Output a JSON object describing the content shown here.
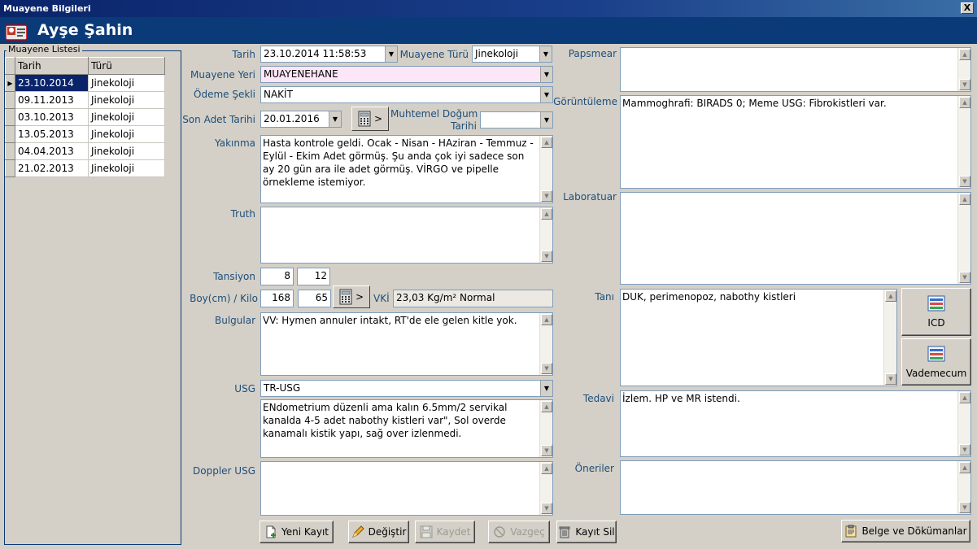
{
  "window": {
    "title": "Muayene Bilgileri",
    "close_glyph": "X"
  },
  "patient": {
    "name": "Ayşe Şahin"
  },
  "list": {
    "group_label": "Muayene Listesi",
    "columns": [
      "Tarih",
      "Türü"
    ],
    "rows": [
      {
        "date": "23.10.2014",
        "type": "Jinekoloji",
        "selected": true
      },
      {
        "date": "09.11.2013",
        "type": "Jinekoloji"
      },
      {
        "date": "03.10.2013",
        "type": "Jinekoloji"
      },
      {
        "date": "13.05.2013",
        "type": "Jinekoloji"
      },
      {
        "date": "04.04.2013",
        "type": "Jinekoloji"
      },
      {
        "date": "21.02.2013",
        "type": "Jinekoloji"
      }
    ]
  },
  "form": {
    "tarih": {
      "label": "Tarih",
      "value": "23.10.2014 11:58:53"
    },
    "muayene_turu": {
      "label": "Muayene Türü",
      "value": "Jinekoloji"
    },
    "muayene_yeri": {
      "label": "Muayene Yeri",
      "value": "MUAYENEHANE"
    },
    "odeme_sekli": {
      "label": "Ödeme Şekli",
      "value": "NAKİT"
    },
    "son_adet_tarihi": {
      "label": "Son Adet Tarihi",
      "value": "20.01.2016"
    },
    "muhtemel_dogum": {
      "label_line1": "Muhtemel Doğum",
      "label_line2": "Tarihi",
      "value": ""
    },
    "yakinma": {
      "label": "Yakınma",
      "value": "Hasta kontrole geldi. Ocak - Nisan - HAziran - Temmuz - Eylül - Ekim Adet görmüş. Şu anda çok iyi sadece son ay 20 gün ara ile adet görmüş. VİRGO ve pipelle örnekleme istemiyor."
    },
    "truth": {
      "label": "Truth",
      "value": ""
    },
    "tansiyon": {
      "label": "Tansiyon",
      "value1": "8",
      "value2": "12"
    },
    "boy_kilo": {
      "label": "Boy(cm) / Kilo",
      "boy": "168",
      "kilo": "65"
    },
    "vki": {
      "label": "VKİ",
      "value": "23,03 Kg/m² Normal"
    },
    "bulgular": {
      "label": "Bulgular",
      "value": "VV: Hymen annuler intakt, RT'de ele gelen kitle yok."
    },
    "usg": {
      "label": "USG",
      "select": "TR-USG",
      "value": "ENdometrium düzenli ama kalın 6.5mm/2 servikal kanalda 4-5 adet nabothy kistleri var\", Sol overde kanamalı kistik yapı, sağ over izlenmedi."
    },
    "doppler_usg": {
      "label": "Doppler USG",
      "value": ""
    },
    "papsmear": {
      "label": "Papsmear",
      "value": ""
    },
    "goruntuleme": {
      "label": "Görüntüleme",
      "value": "Mammoghrafi: BIRADS 0; Meme USG: Fibrokistleri var."
    },
    "laboratuar": {
      "label": "Laboratuar",
      "value": ""
    },
    "tani": {
      "label": "Tanı",
      "value": "DUK, perimenopoz, nabothy kistleri"
    },
    "tedavi": {
      "label": "Tedavi",
      "value": "İzlem. HP ve MR istendi."
    },
    "oneriler": {
      "label": "Öneriler",
      "value": ""
    }
  },
  "buttons": {
    "calc_arrow": ">",
    "icd": "ICD",
    "vademecum": "Vademecum",
    "yeni_kayit": "Yeni Kayıt",
    "degistir": "Değiştir",
    "kaydet": "Kaydet",
    "vazgec": "Vazgeç",
    "kayit_sil": "Kayıt Sil",
    "belge": "Belge ve Dökümanlar"
  },
  "icons": {
    "patient": "patient-card-icon",
    "calculator": "calculator-icon",
    "dropdown": "chevron-down-icon",
    "scroll_up": "scroll-up-icon",
    "scroll_down": "scroll-down-icon",
    "row_pointer": "row-pointer-icon"
  },
  "colors": {
    "title_bar": "#0a246a",
    "header_bar": "#0b3a78",
    "label_text": "#1f4e79",
    "selected_row": "#0a246a",
    "pink_field": "#fde6f8",
    "window_bg": "#d4d0c8"
  }
}
